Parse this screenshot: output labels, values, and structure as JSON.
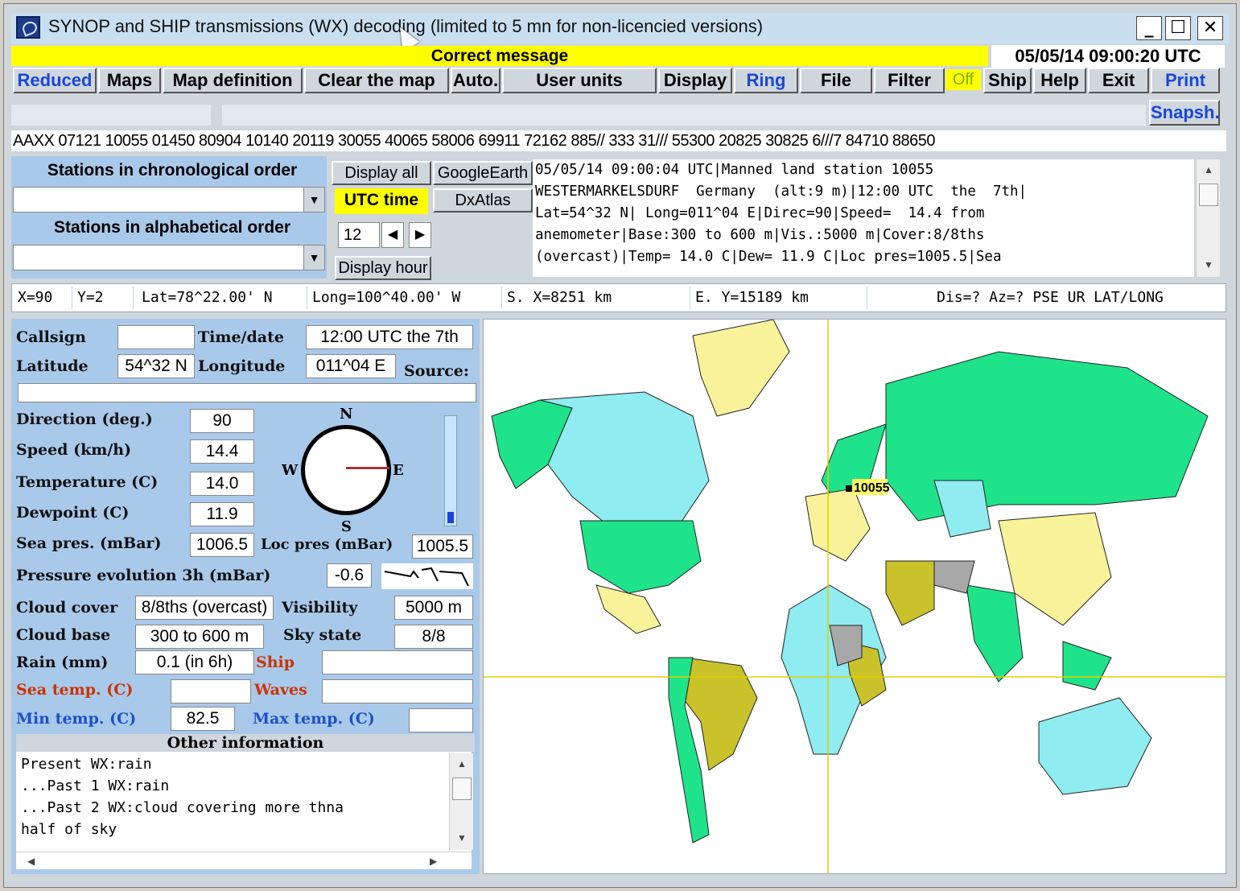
{
  "window": {
    "title": "SYNOP and SHIP transmissions (WX) decoding (limited to 5 mn for non-licencied versions)",
    "controls": [
      "_",
      "☐",
      "✕"
    ]
  },
  "status": {
    "message": "Correct message",
    "datetime": "05/05/14 09:00:20 UTC"
  },
  "toolbar": {
    "reduced": "Reduced",
    "maps": "Maps",
    "map_definition": "Map definition",
    "clear_map": "Clear the map",
    "auto": "Auto.",
    "user_units": "User units",
    "display": "Display",
    "ring": "Ring",
    "file": "File",
    "filter": "Filter",
    "off": "Off",
    "ship": "Ship",
    "help": "Help",
    "exit": "Exit",
    "print": "Print",
    "snapsh": "Snapsh."
  },
  "raw_message": "AAXX 07121  10055 01450 80904 10140 20119 30055 40065 58006 69911 72162 885//    333 31/// 55300 20825 30825 6///7 84710 88650",
  "stations": {
    "chrono_label": "Stations in chronological order",
    "alpha_label": "Stations in alphabetical order",
    "display_all": "Display all",
    "google_earth": "GoogleEarth",
    "utc_time": "UTC time",
    "dxatlas": "DxAtlas",
    "hour_value": "12",
    "display_hour": "Display hour"
  },
  "decoded_text": "05/05/14 09:00:04 UTC|Manned land station 10055\nWESTERMARKELSDURF  Germany  (alt:9 m)|12:00 UTC  the  7th|\nLat=54^32 N| Long=011^04 E|Direc=90|Speed=  14.4 from\nanemometer|Base:300 to 600 m|Vis.:5000 m|Cover:8/8ths\n(overcast)|Temp= 14.0 C|Dew= 11.9 C|Loc pres=1005.5|Sea",
  "coords": {
    "x": "X=90",
    "y": "Y=2",
    "lat": "Lat=78^22.00' N",
    "long": "Long=100^40.00' W",
    "sx": "S. X=8251 km",
    "ey": "E. Y=15189 km",
    "dis": "Dis=? Az=? PSE UR LAT/LONG"
  },
  "fields": {
    "callsign_label": "Callsign",
    "callsign": "",
    "timedate_label": "Time/date",
    "timedate": "12:00 UTC  the  7th",
    "latitude_label": "Latitude",
    "latitude": "54^32 N",
    "longitude_label": "Longitude",
    "longitude": "011^04 E",
    "source_label": "Source:",
    "source": "",
    "direction_label": "Direction (deg.)",
    "direction": "90",
    "speed_label": "Speed (km/h)",
    "speed": "14.4",
    "temperature_label": "Temperature (C)",
    "temperature": "14.0",
    "dewpoint_label": "Dewpoint (C)",
    "dewpoint": "11.9",
    "seapres_label": "Sea pres. (mBar)",
    "seapres": "1006.5",
    "locpres_label": "Loc pres (mBar)",
    "locpres": "1005.5",
    "pressevo_label": "Pressure evolution 3h (mBar)",
    "pressevo": "-0.6",
    "cloudcover_label": "Cloud cover",
    "cloudcover": "8/8ths (overcast)",
    "visibility_label": "Visibility",
    "visibility": "5000 m",
    "cloudbase_label": "Cloud base",
    "cloudbase": "300 to 600 m",
    "skystate_label": "Sky state",
    "skystate": "8/8",
    "rain_label": "Rain (mm)",
    "rain": "0.1 (in 6h)",
    "ship_label": "Ship",
    "ship": "",
    "seatemp_label": "Sea temp. (C)",
    "seatemp": "",
    "waves_label": "Waves",
    "waves": "",
    "mintemp_label": "Min temp. (C)",
    "mintemp": "82.5",
    "maxtemp_label": "Max temp. (C)",
    "maxtemp": ""
  },
  "compass": {
    "n": "N",
    "s": "S",
    "e": "E",
    "w": "W",
    "direction_deg": 90
  },
  "other_info": {
    "title": "Other information",
    "lines": [
      "Present WX:rain",
      "...Past 1 WX:rain",
      "...Past 2 WX:cloud covering more thna",
      "half of sky"
    ]
  },
  "map": {
    "station_label": "10055",
    "colors": {
      "green": "#1fe38a",
      "cyan": "#8fecf0",
      "yellow": "#f8f29a",
      "olive": "#c9c22a",
      "gray": "#a8a8a8",
      "crosshair": "#e0d000"
    }
  }
}
